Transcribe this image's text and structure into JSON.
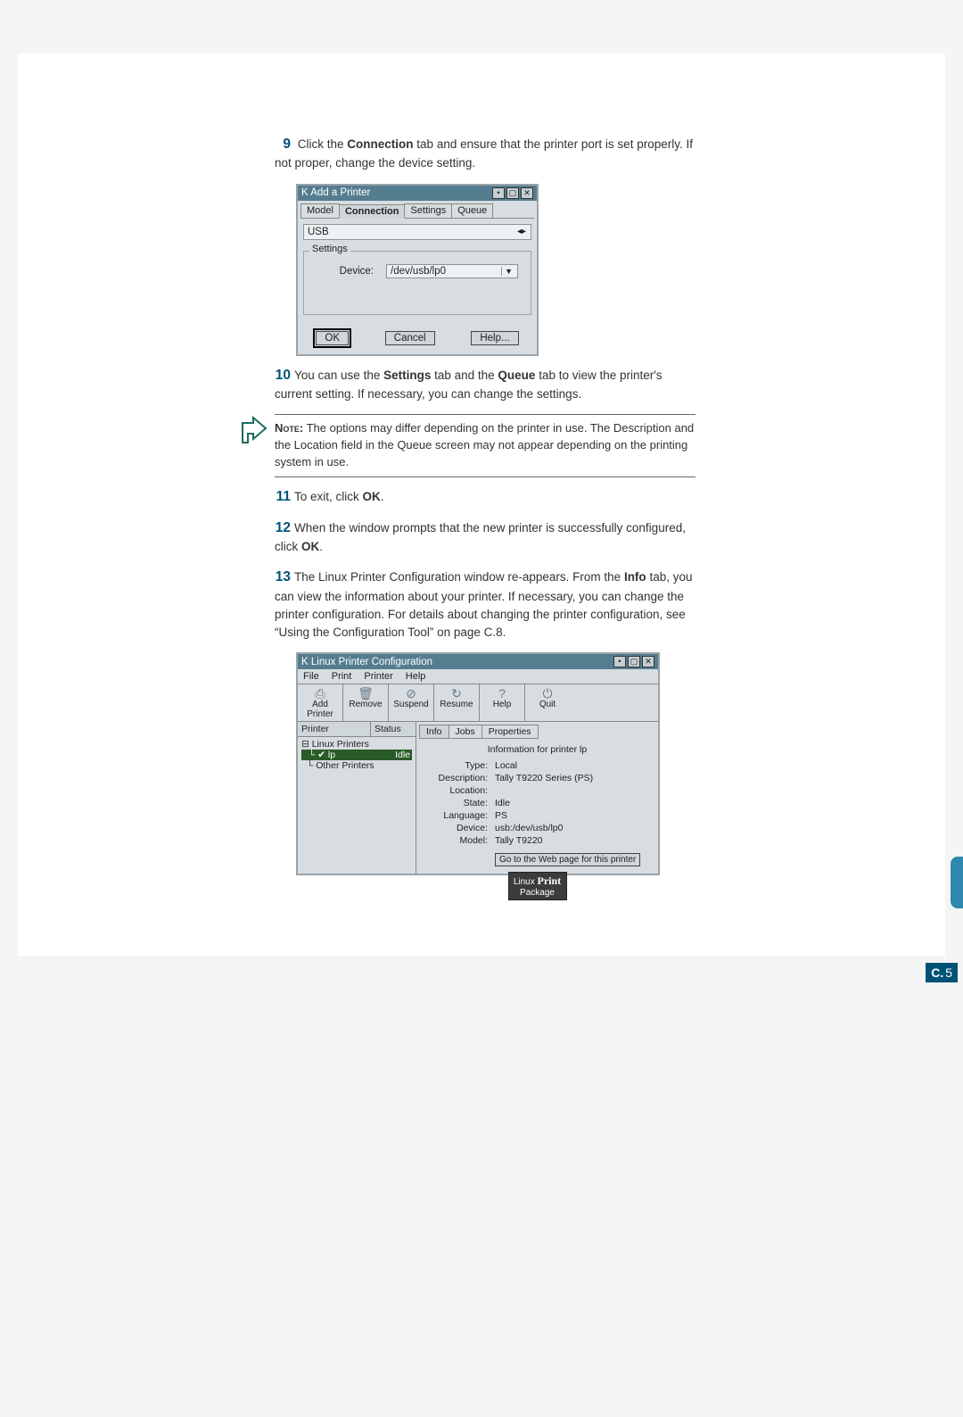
{
  "steps": {
    "s9": {
      "num": "9",
      "text_a": "Click the ",
      "bold_a": "Connection",
      "text_b": " tab and ensure that the printer port is set properly. If not proper, change the device setting."
    },
    "s10": {
      "num": "10",
      "text_a": "You can use the ",
      "bold_a": "Settings",
      "text_b": " tab and the ",
      "bold_b": "Queue",
      "text_c": " tab to view the printer's current setting. If necessary, you can change the settings."
    },
    "s11": {
      "num": "11",
      "text_a": "To exit, click ",
      "bold_a": "OK",
      "text_b": "."
    },
    "s12": {
      "num": "12",
      "text_a": "When the window prompts that the new printer is successfully configured, click ",
      "bold_a": "OK",
      "text_b": "."
    },
    "s13": {
      "num": "13",
      "text_a": "The Linux Printer Configuration window re-appears. From the ",
      "bold_a": "Info",
      "text_b": " tab, you can view the information about your printer. If necessary, you can change the printer configuration. For details about changing the printer configuration, see “Using the Configuration Tool” on page C.8."
    }
  },
  "note": {
    "label": "Note:",
    "text": " The options may differ depending on the printer in use. The Description and the Location field in the Queue screen may not appear depending on the printing system in use."
  },
  "dlg1": {
    "title": "Add a Printer",
    "tabs": [
      "Model",
      "Connection",
      "Settings",
      "Queue"
    ],
    "active_tab": 1,
    "top_field": "USB",
    "fieldset_label": "Settings",
    "device_label": "Device:",
    "device_value": "/dev/usb/lp0",
    "ok": "OK",
    "cancel": "Cancel",
    "help": "Help..."
  },
  "dlg2": {
    "title": "Linux Printer Configuration",
    "menus": [
      "File",
      "Print",
      "Printer",
      "Help"
    ],
    "toolbar": [
      "Add Printer",
      "Remove",
      "Suspend",
      "Resume",
      "Help",
      "Quit"
    ],
    "left_headers": [
      "Printer",
      "Status"
    ],
    "tree": {
      "root": "Linux Printers",
      "item": "lp",
      "status": "Idle",
      "other": "Other Printers"
    },
    "right_tabs": [
      "Info",
      "Jobs",
      "Properties"
    ],
    "info_header": "Information for printer lp",
    "kv": [
      {
        "k": "Type:",
        "v": "Local"
      },
      {
        "k": "Description:",
        "v": "Tally T9220 Series (PS)"
      },
      {
        "k": "Location:",
        "v": ""
      },
      {
        "k": "State:",
        "v": "Idle"
      },
      {
        "k": "Language:",
        "v": "PS"
      },
      {
        "k": "Device:",
        "v": "usb:/dev/usb/lp0"
      },
      {
        "k": "Model:",
        "v": "Tally T9220"
      }
    ],
    "go_btn": "Go to the Web page for this printer",
    "logo_a": "Linux ",
    "logo_b": "Print",
    "logo_c": "Package"
  },
  "appendix_letter": "C",
  "page_prefix": "C.",
  "page_num": "5"
}
